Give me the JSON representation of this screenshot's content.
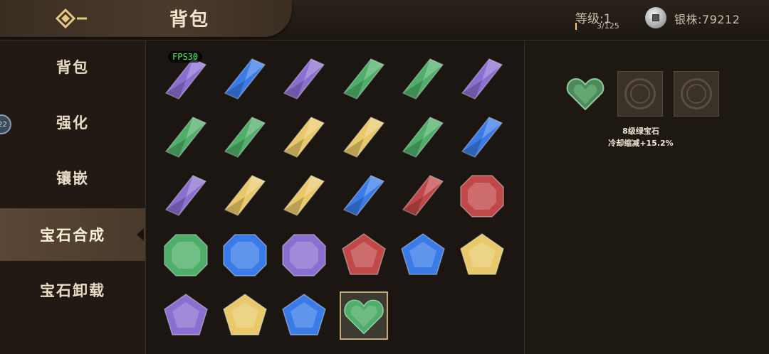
{
  "header": {
    "title": "背包",
    "level": "等级:1",
    "xp": "3/125",
    "silver": "银株:79212"
  },
  "sidebar": {
    "items": [
      {
        "label": "背包"
      },
      {
        "label": "强化"
      },
      {
        "label": "镶嵌"
      },
      {
        "label": "宝石合成"
      },
      {
        "label": "宝石卸载"
      }
    ],
    "active_index": 3,
    "badge": "22"
  },
  "fps": "FPS30",
  "colors": {
    "purple": "#8a6fd0",
    "blue": "#3a7be8",
    "green": "#4fae6a",
    "yellow": "#e8c868",
    "red": "#c04848",
    "accent": "#c8a878"
  },
  "gems": [
    {
      "shape": "diamond",
      "color": "purple"
    },
    {
      "shape": "diamond",
      "color": "blue"
    },
    {
      "shape": "diamond",
      "color": "purple"
    },
    {
      "shape": "diamond",
      "color": "green"
    },
    {
      "shape": "diamond",
      "color": "green"
    },
    {
      "shape": "diamond",
      "color": "purple"
    },
    {
      "shape": "diamond",
      "color": "green"
    },
    {
      "shape": "diamond",
      "color": "green"
    },
    {
      "shape": "diamond",
      "color": "yellow"
    },
    {
      "shape": "diamond",
      "color": "yellow"
    },
    {
      "shape": "diamond",
      "color": "green"
    },
    {
      "shape": "diamond",
      "color": "blue"
    },
    {
      "shape": "diamond",
      "color": "purple"
    },
    {
      "shape": "diamond",
      "color": "yellow"
    },
    {
      "shape": "diamond",
      "color": "yellow"
    },
    {
      "shape": "diamond",
      "color": "blue"
    },
    {
      "shape": "diamond",
      "color": "red"
    },
    {
      "shape": "octagon",
      "color": "red"
    },
    {
      "shape": "octagon",
      "color": "green"
    },
    {
      "shape": "octagon",
      "color": "blue"
    },
    {
      "shape": "octagon",
      "color": "purple"
    },
    {
      "shape": "pentagon",
      "color": "red"
    },
    {
      "shape": "pentagon",
      "color": "blue"
    },
    {
      "shape": "pentagon",
      "color": "yellow"
    },
    {
      "shape": "pentagon",
      "color": "purple"
    },
    {
      "shape": "pentagon",
      "color": "yellow"
    },
    {
      "shape": "pentagon",
      "color": "blue"
    },
    {
      "shape": "heart",
      "color": "green",
      "selected": true
    }
  ],
  "detail": {
    "name": "8级绿宝石",
    "effect": "冷却缩减+15.2%"
  }
}
